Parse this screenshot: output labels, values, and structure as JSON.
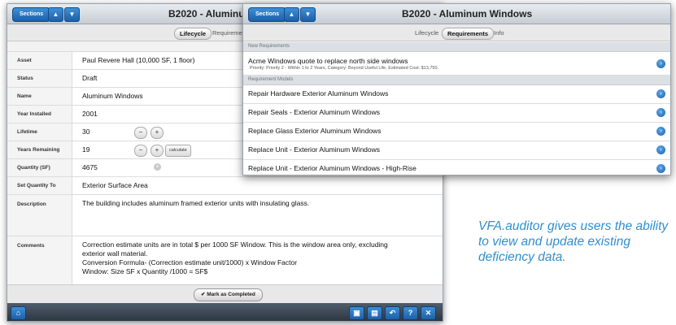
{
  "back": {
    "sections_label": "Sections",
    "title": "B2020 - Aluminum",
    "tabs": [
      "Lifecycle",
      "Requireme"
    ],
    "fields": [
      {
        "label": "Asset",
        "value": "Paul Revere Hall (10,000 SF, 1 floor)"
      },
      {
        "label": "Status",
        "value": "Draft"
      },
      {
        "label": "Name",
        "value": "Aluminum Windows"
      },
      {
        "label": "Year Installed",
        "value": "2001"
      },
      {
        "label": "Lifetime",
        "value": "30"
      },
      {
        "label": "Years Remaining",
        "value": "19"
      },
      {
        "label": "Quantity (SF)",
        "value": "4675"
      },
      {
        "label": "Set Quantity To",
        "value": "Exterior Surface Area"
      }
    ],
    "calculate_label": "calculate",
    "description_label": "Description",
    "description": "The building includes aluminum framed exterior units with insulating glass.",
    "comments_label": "Comments",
    "comments": [
      "Correction estimate units are in total $ per 1000 SF Window. This is the window area only, excluding",
      "exterior wall material.",
      "Conversion Formula- (Correction estimate unit/1000) x Window Factor",
      "Window: Size SF x Quantity /1000 = SF$"
    ],
    "mark_completed": "Mark as Completed"
  },
  "front": {
    "sections_label": "Sections",
    "title": "B2020 - Aluminum Windows",
    "tabs": [
      "Lifecycle",
      "Requirements",
      "Info"
    ],
    "new_requirements_header": "New Requirements",
    "new_requirement": {
      "title": "Acme Windows quote to replace north side windows",
      "detail": "Priority: Priority 2 - Within 1 to 2 Years, Category: Beyond Useful Life, Estimated Cost: $13,750."
    },
    "models_header": "Requirement Models",
    "models": [
      "Repair Hardware Exterior Aluminum Windows",
      "Repair Seals - Exterior Aluminum Windows",
      "Replace Glass Exterior Aluminum Windows",
      "Replace Unit - Exterior Aluminum Windows",
      "Replace Unit - Exterior Aluminum Windows - High-Rise"
    ]
  },
  "caption": "VFA.auditor gives users the ability to view and update existing deficiency data.",
  "colors": {
    "accent": "#1c5fa8",
    "caption": "#2f8fd0"
  }
}
